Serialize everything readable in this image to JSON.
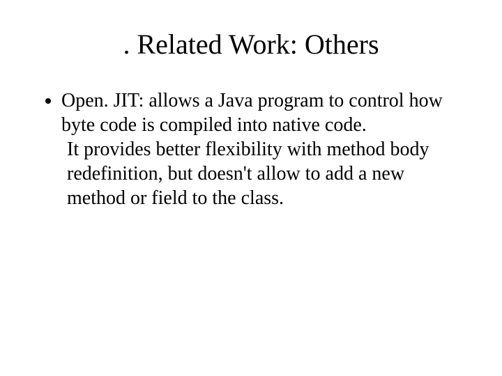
{
  "slide": {
    "title": ". Related Work: Others",
    "bullet1_line1": "Open. JIT: allows a Java program to control how byte code is compiled into native code.",
    "bullet1_line2": "It provides better flexibility with method body redefinition, but doesn't allow to add a new method or field to the class."
  }
}
